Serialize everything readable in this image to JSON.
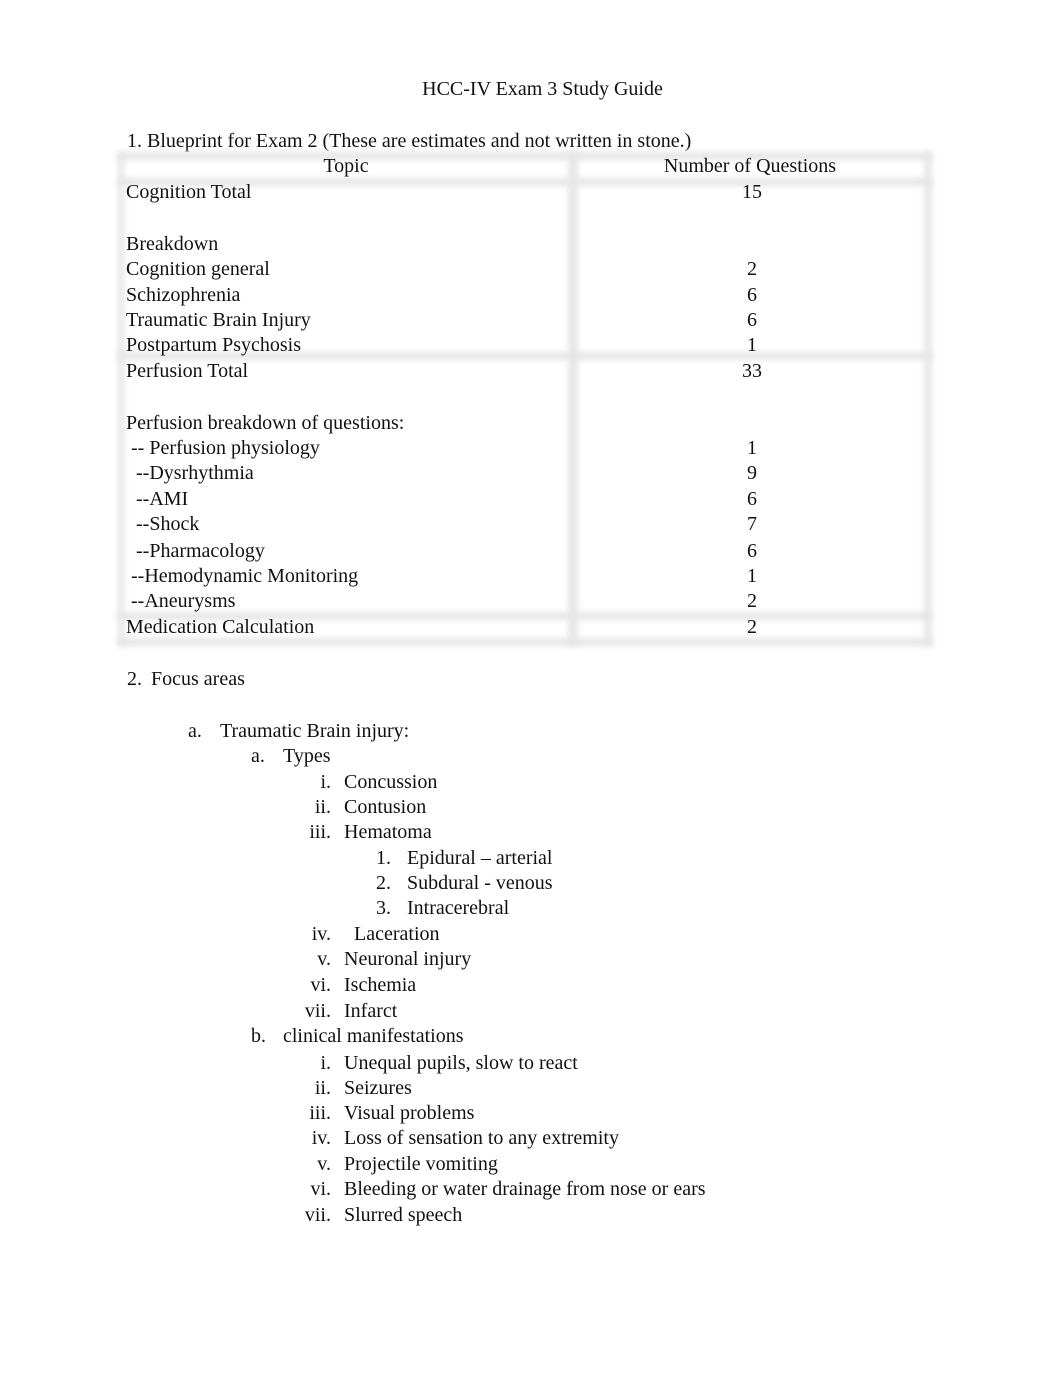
{
  "document": {
    "title": "HCC-IV Exam 3 Study Guide",
    "section1_heading": "1. Blueprint for Exam 2 (These are estimates and not written in stone.)",
    "table": {
      "headers": [
        "Topic",
        "Number of Questions"
      ],
      "rows": [
        {
          "topic": "Cognition Total",
          "count": "15"
        },
        {
          "topic": "Breakdown",
          "count": ""
        },
        {
          "topic": "Cognition general",
          "count": "2"
        },
        {
          "topic": "Schizophrenia",
          "count": "6"
        },
        {
          "topic": "Traumatic Brain Injury",
          "count": "6"
        },
        {
          "topic": "Postpartum Psychosis",
          "count": "1"
        },
        {
          "topic": "Perfusion Total",
          "count": "33"
        },
        {
          "topic": "Perfusion breakdown of questions:",
          "count": ""
        },
        {
          "topic": " -- Perfusion physiology",
          "count": "1"
        },
        {
          "topic": "  --Dysrhythmia",
          "count": "9"
        },
        {
          "topic": "  --AMI",
          "count": "6"
        },
        {
          "topic": "  --Shock",
          "count": "7"
        },
        {
          "topic": "  --Pharmacology",
          "count": "6"
        },
        {
          "topic": " --Hemodynamic Monitoring",
          "count": "1"
        },
        {
          "topic": " --Aneurysms",
          "count": "2"
        },
        {
          "topic": "Medication Calculation",
          "count": "2"
        }
      ]
    },
    "section2_heading": {
      "marker": "2.",
      "text": "Focus areas"
    },
    "focus": {
      "a": {
        "marker": "a.",
        "text": "Traumatic Brain injury:"
      },
      "types": {
        "marker": "a.",
        "text": "Types"
      },
      "type_items": [
        {
          "marker": "i.",
          "text": "Concussion"
        },
        {
          "marker": "ii.",
          "text": "Contusion"
        },
        {
          "marker": "iii.",
          "text": "Hematoma"
        },
        {
          "marker": "iv.",
          "text": "Laceration"
        },
        {
          "marker": "v.",
          "text": "Neuronal injury"
        },
        {
          "marker": "vi.",
          "text": "Ischemia"
        },
        {
          "marker": "vii.",
          "text": "Infarct"
        }
      ],
      "hematoma_items": [
        {
          "marker": "1.",
          "text": "Epidural – arterial"
        },
        {
          "marker": "2.",
          "text": "Subdural - venous"
        },
        {
          "marker": "3.",
          "text": "Intracerebral"
        }
      ],
      "clinical": {
        "marker": "b.",
        "text": "clinical manifestations"
      },
      "clinical_items": [
        {
          "marker": "i.",
          "text": "Unequal pupils, slow to react"
        },
        {
          "marker": "ii.",
          "text": "Seizures"
        },
        {
          "marker": "iii.",
          "text": "Visual problems"
        },
        {
          "marker": "iv.",
          "text": "Loss of sensation to any extremity"
        },
        {
          "marker": "v.",
          "text": "Projectile vomiting"
        },
        {
          "marker": "vi.",
          "text": "Bleeding or water drainage from nose or ears"
        },
        {
          "marker": "vii.",
          "text": "Slurred speech"
        }
      ]
    }
  }
}
